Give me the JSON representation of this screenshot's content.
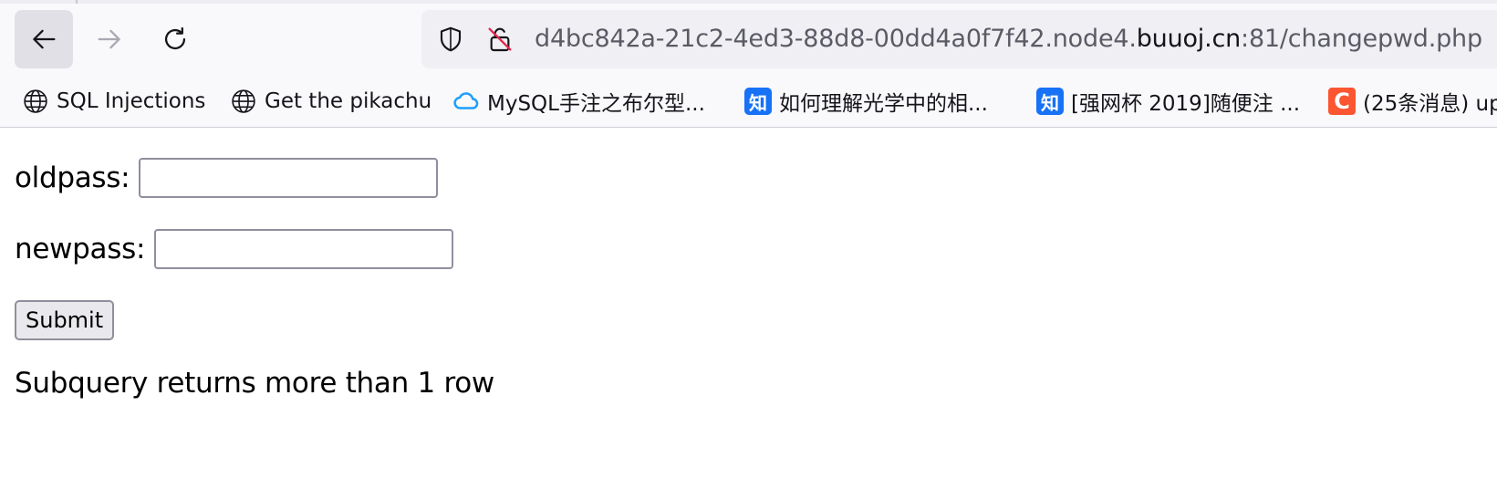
{
  "browser": {
    "url": {
      "prefix": "d4bc842a-21c2-4ed3-88d8-00dd4a0f7f42.node4.",
      "host": "buuoj.cn",
      "suffix": ":81/changepwd.php"
    },
    "nav": {
      "back_icon": "arrow-left-icon",
      "forward_icon": "arrow-right-icon",
      "reload_icon": "reload-icon",
      "forward_enabled": false
    },
    "url_icons": [
      "shield-icon",
      "insecure-lock-icon"
    ],
    "bookmarks": [
      {
        "label": "SQL Injections",
        "icon": "globe-icon"
      },
      {
        "label": "Get the pikachu",
        "icon": "globe-icon"
      },
      {
        "label": "MySQL手注之布尔型...",
        "icon": "cloud-icon"
      },
      {
        "label": "如何理解光学中的相...",
        "icon": "zhihu-icon",
        "icon_text": "知"
      },
      {
        "label": "[强网杯 2019]随便注 ...",
        "icon": "zhihu-icon",
        "icon_text": "知"
      },
      {
        "label": "(25条消息) up",
        "icon": "csdn-icon",
        "icon_text": "C"
      }
    ]
  },
  "form": {
    "oldpass_label": "oldpass:",
    "oldpass_value": "",
    "newpass_label": "newpass:",
    "newpass_value": "",
    "submit_label": "Submit"
  },
  "message": "Subquery returns more than 1 row",
  "colors": {
    "chrome_bg": "#f9f9fb",
    "urlbar_bg": "#f0f0f4",
    "zhihu_blue": "#1772f6",
    "csdn_orange": "#fc5531",
    "cloud_blue": "#1e9fff"
  }
}
